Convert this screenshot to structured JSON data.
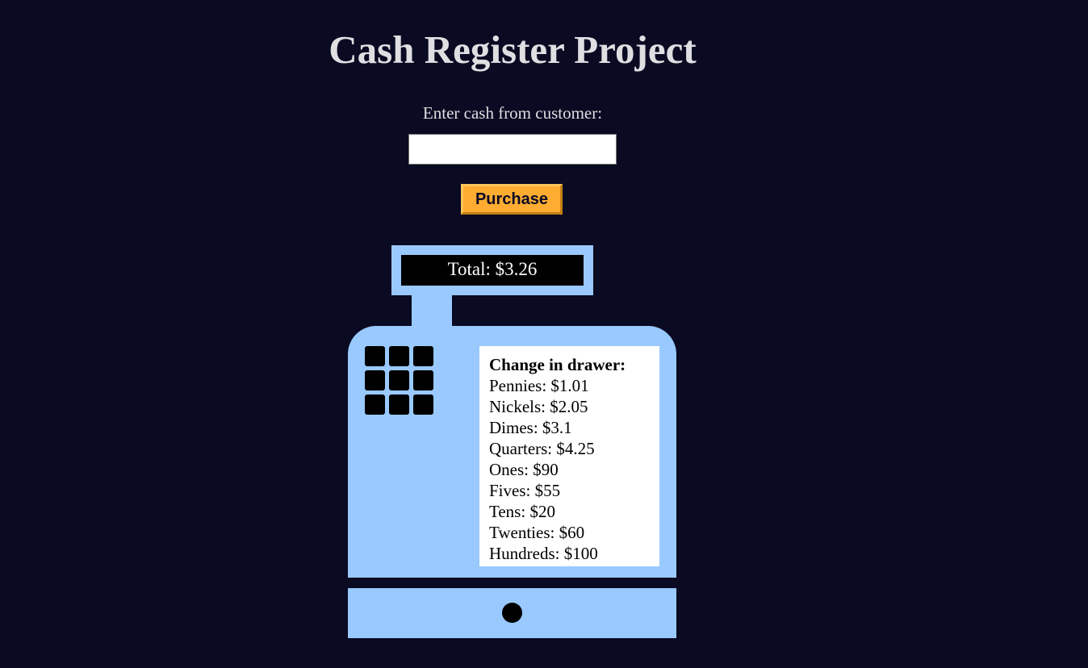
{
  "page": {
    "title": "Cash Register Project",
    "cash_label": "Enter cash from customer:",
    "cash_input": {
      "value": "",
      "placeholder": ""
    },
    "purchase_button": "Purchase"
  },
  "register": {
    "total_text": "Total: $3.26",
    "drawer": {
      "title": "Change in drawer:",
      "items": [
        "Pennies: $1.01",
        "Nickels: $2.05",
        "Dimes: $3.1",
        "Quarters: $4.25",
        "Ones: $90",
        "Fives: $55",
        "Tens: $20",
        "Twenties: $60",
        "Hundreds: $100"
      ]
    },
    "keypad_keys": 9
  },
  "colors": {
    "background": "#0a0a23",
    "register_body": "#99c9ff",
    "button": "#feac32",
    "text": "#dfdfe2"
  }
}
